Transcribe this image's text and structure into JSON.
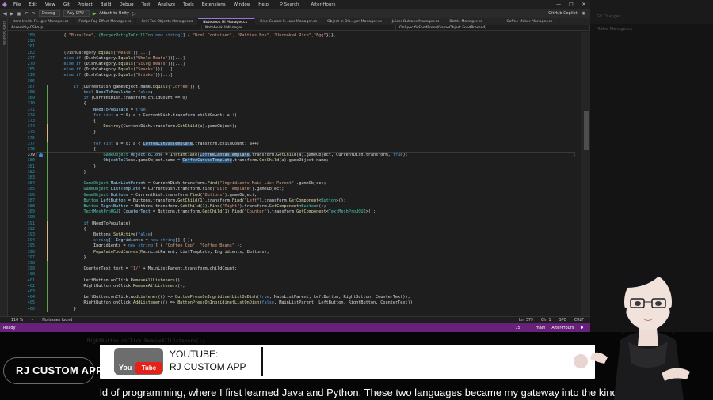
{
  "menu": {
    "items": [
      "File",
      "Edit",
      "View",
      "Git",
      "Project",
      "Build",
      "Debug",
      "Test",
      "Analyze",
      "Tools",
      "Extensions",
      "Window",
      "Help"
    ],
    "search": "Search",
    "window_title": "After-Hours"
  },
  "toolbar": {
    "config": "Debug",
    "platform": "Any CPU",
    "attach": "Attach to Unity",
    "copilot": "GitHub Copilot"
  },
  "tabs": [
    "Item Inside Fr...ger Manager.cs",
    "Fridge Fog Effect Manager.cs",
    "Grill Top Objects Manager.cs",
    "Notebook UI Manager.cs",
    "Rice Cooker E...ons Manager.cs",
    "Object In Dis...yer Manager.cs",
    "Juicer Buttons Manager.cs",
    "Bottle Manager.cs",
    "Coffee Maker Manager.cs"
  ],
  "left_strip": "Data Sources",
  "navbar": [
    "Assembly-CSharp",
    "NotebookUIManager",
    "OnSpecificFoodPress(GameObject FoodPressed)"
  ],
  "editor": {
    "lines": [
      {
        "n": "289",
        "html": "    <span class='f'>{</span> <span class='s'>\"Burailou\"</span>, <span class='t'>(BurgerPattyInGrillTop,</span><span class='k'>new</span> <span class='k'>string</span>[] { <span class='s'>\"Bcml Container\"</span>, <span class='s'>\"Patties Box\"</span>, <span class='s'>\"Uncooked Rice\"</span>,<span class='s'>\"Egg\"</span>}}},"
      },
      {
        "n": "290",
        "html": ""
      },
      {
        "n": "261",
        "html": ""
      },
      {
        "n": "262",
        "html": "    <span class='f'>(DishCategory.</span><span class='m'>Equals</span>(<span class='s'>\"Meals\"</span>))<span class='f'>[...]</span>"
      },
      {
        "n": "277",
        "html": "    <span class='k'>else if</span> (DishCategory.<span class='m'>Equals</span>(<span class='s'>\"Whole Meats\"</span>))<span class='f'>[...]</span>"
      },
      {
        "n": "279",
        "html": "    <span class='k'>else if</span> (DishCategory.<span class='m'>Equals</span>(<span class='s'>\"Silog Meals\"</span>))<span class='f'>[...]</span>"
      },
      {
        "n": "285",
        "html": "    <span class='k'>else if</span> (DishCategory.<span class='m'>Equals</span>(<span class='s'>\"Snacks\"</span>))<span class='f'>[...]</span>"
      },
      {
        "n": "319",
        "html": "    <span class='k'>else if</span> (DishCategory.<span class='m'>Equals</span>(<span class='s'>\"Drinks\"</span>))<span class='f'>[...]</span>"
      },
      {
        "n": "366",
        "html": ""
      },
      {
        "n": "367",
        "html": "        <span class='k'>if</span> (CurrentDish.gameObject.name.<span class='m'>Equals</span>(<span class='s'>\"Coffee\"</span>)) {"
      },
      {
        "n": "368",
        "html": "            <span class='k'>bool</span> <span class='v'>NeedToPopulate</span> = <span class='k'>false</span>;"
      },
      {
        "n": "369",
        "html": "            <span class='k'>if</span> (CurrentDish.transform.childCount == <span class='n'>0</span>)"
      },
      {
        "n": "370",
        "html": "            {"
      },
      {
        "n": "371",
        "html": "                <span class='v'>NeedToPopulate</span> = <span class='k'>true</span>;"
      },
      {
        "n": "372",
        "html": "                <span class='k'>for</span> (<span class='k'>int</span> <span class='v'>a</span> = <span class='n'>0</span>; a &lt; CurrentDish.transform.childCount; a++)"
      },
      {
        "n": "373",
        "html": "                {"
      },
      {
        "n": "374",
        "html": "                    <span class='m'>Destroy</span>(CurrentDish.transform.<span class='m'>GetChild</span>(a).gameObject);"
      },
      {
        "n": "375",
        "html": "                }"
      },
      {
        "n": "376",
        "html": ""
      },
      {
        "n": "377",
        "html": "                <span class='k'>for</span> (<span class='k'>int</span> <span class='v'>a</span> = <span class='n'>0</span>; a &lt; <span class='hl'>CoffeeCanvasTemplate</span>.transform.childCount; a++)"
      },
      {
        "n": "378",
        "html": "                {"
      },
      {
        "n": "379",
        "html": "                    <span class='t'>GameObject</span> <span class='v'>ObjectToClone</span> = <span class='m'>Instantiate</span>(<span class='hl'>CoffeeCanvasTemplate</span>.transform.<span class='m'>GetChild</span>(a).gameObject, CurrentDish.transform, <span class='k'>true</span>);"
      },
      {
        "n": "380",
        "html": "                    <span class='v'>ObjectToClone</span>.gameObject.name = <span class='hl'>CoffeeCanvasTemplate</span>.transform.<span class='m'>GetChild</span>(a).gameObject.name;"
      },
      {
        "n": "381",
        "html": "                }"
      },
      {
        "n": "382",
        "html": "            }"
      },
      {
        "n": "383",
        "html": ""
      },
      {
        "n": "384",
        "html": "            <span class='t'>GameObject</span> <span class='v'>MainListParent</span> = CurrentDish.transform.<span class='m'>Find</span>(<span class='s'>\"Ingridients Main List Parent\"</span>).gameObject;"
      },
      {
        "n": "385",
        "html": "            <span class='t'>GameObject</span> <span class='v'>ListTemplate</span> = CurrentDish.transform.<span class='m'>Find</span>(<span class='s'>\"List Template\"</span>).gameObject;"
      },
      {
        "n": "386",
        "html": "            <span class='t'>GameObject</span> <span class='v'>Buttons</span> = CurrentDish.transform.<span class='m'>Find</span>(<span class='s'>\"Buttons\"</span>).gameObject;"
      },
      {
        "n": "387",
        "html": "            <span class='t'>Button</span> <span class='v'>LeftButton</span> = Buttons.transform.<span class='m'>GetChild</span>(<span class='n'>1</span>).transform.<span class='m'>Find</span>(<span class='s'>\"Left\"</span>).transform.<span class='m'>GetComponent</span>&lt;<span class='t'>Button</span>&gt;();"
      },
      {
        "n": "388",
        "html": "            <span class='t'>Button</span> <span class='v'>RightButton</span> = Buttons.transform.<span class='m'>GetChild</span>(<span class='n'>1</span>).<span class='m'>Find</span>(<span class='s'>\"Right\"</span>).transform.<span class='m'>GetComponent</span>&lt;<span class='t'>Button</span>&gt;();"
      },
      {
        "n": "389",
        "html": "            <span class='t'>TextMeshProUGUI</span> <span class='v'>CounterText</span> = Buttons.transform.<span class='m'>GetChild</span>(<span class='n'>1</span>).<span class='m'>Find</span>(<span class='s'>\"Counter\"</span>).transform.<span class='m'>GetComponent</span>&lt;<span class='t'>TextMeshProUGUI</span>&gt;();"
      },
      {
        "n": "390",
        "html": ""
      },
      {
        "n": "391",
        "html": "            <span class='k'>if</span> (NeedToPopulate)"
      },
      {
        "n": "392",
        "html": "            {"
      },
      {
        "n": "393",
        "html": "                Buttons.<span class='m'>SetActive</span>(<span class='k'>false</span>);"
      },
      {
        "n": "394",
        "html": "                <span class='k'>string</span>[] <span class='v'>Ingridients</span> = <span class='k'>new</span> <span class='k'>string</span>[] { };"
      },
      {
        "n": "395",
        "html": "                Ingridients = <span class='k'>new</span> <span class='k'>string</span>[] { <span class='s'>\"Coffee Cup\"</span>, <span class='s'>\"Coffee Beans\"</span> };"
      },
      {
        "n": "396",
        "html": "                <span class='m'>PopulateFoodCanvas</span>(MainListParent, ListTemplate, Ingridients, Buttons);"
      },
      {
        "n": "397",
        "html": "            }"
      },
      {
        "n": "398",
        "html": ""
      },
      {
        "n": "399",
        "html": "            CounterText.text = <span class='s'>\"1/\"</span> + MainListParent.transform.childCount;"
      },
      {
        "n": "400",
        "html": ""
      },
      {
        "n": "401",
        "html": "            LeftButton.onClick.<span class='m'>RemoveAllListeners</span>();"
      },
      {
        "n": "402",
        "html": "            RightButton.onClick.<span class='m'>RemoveAllListeners</span>();"
      },
      {
        "n": "403",
        "html": ""
      },
      {
        "n": "404",
        "html": "            LeftButton.onClick.<span class='m'>AddListener</span>(() =&gt; <span class='m'>ButtonPressOnIngridinetListOnDish</span>(<span class='k'>true</span>, MainListParent, LeftButton, RightButton, CounterText));"
      },
      {
        "n": "405",
        "html": "            RightButton.onClick.<span class='m'>AddListener</span>(() =&gt; <span class='m'>ButtonPressOnIngridinetListOnDish</span>(<span class='k'>false</span>, MainListParent, LeftButton, RightButton, CounterText));"
      },
      {
        "n": "406",
        "html": "        }"
      }
    ],
    "current_line": "379"
  },
  "status_row": {
    "zoom": "110 %",
    "issues": "No issues found",
    "position": "Ln: 379",
    "col": "Ch: 1",
    "spc": "SPC",
    "crlf": "CRLF"
  },
  "status_bar": {
    "left": "Ready",
    "branch": "main",
    "repo": "After-Hours",
    "errors": "15"
  },
  "background_window": {
    "title": "Git Changes",
    "file": "Maker Manager.cs"
  },
  "faded_code": "    RightButton.onClick.RemoveAllListeners();",
  "banner": {
    "logo_word": "You",
    "logo_tube": "Tube",
    "line1": "YOUTUBE:",
    "line2": "RJ CUSTOM APP"
  },
  "brand": "RJ CUSTOM APP",
  "caption": "ld of programming, where I first learned Java and Python. These two languages became my gateway into the kind of"
}
